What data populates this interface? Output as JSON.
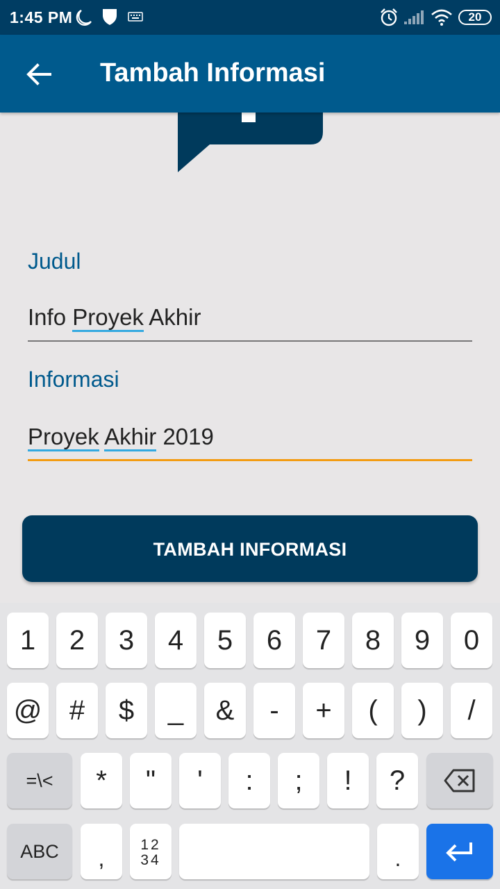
{
  "status_bar": {
    "time": "1:45 PM",
    "battery": "20",
    "icons": [
      "moon-icon",
      "shield-icon",
      "keyboard-icon",
      "alarm-icon",
      "signal-icon",
      "wifi-icon",
      "battery-icon"
    ]
  },
  "app_bar": {
    "title": "Tambah Informasi",
    "back_icon": "back-arrow-icon"
  },
  "form": {
    "judul_label": "Judul",
    "judul_value_words": [
      "Info",
      "Proyek",
      "Akhir"
    ],
    "informasi_label": "Informasi",
    "informasi_value_words": [
      "Proyek",
      "Akhir",
      "2019"
    ],
    "focused_field": "informasi",
    "submit_label": "TAMBAH INFORMASI"
  },
  "colors": {
    "status_bar": "#003d63",
    "app_bar": "#005a8d",
    "label": "#005a8d",
    "button": "#003a5c",
    "focus_underline": "#f39c12",
    "spell_underline": "#33a9e0",
    "enter_key": "#1a73e8"
  },
  "keyboard": {
    "row1": [
      "1",
      "2",
      "3",
      "4",
      "5",
      "6",
      "7",
      "8",
      "9",
      "0"
    ],
    "row2": [
      "@",
      "#",
      "$",
      "_",
      "&",
      "-",
      "+",
      "(",
      ")",
      "/"
    ],
    "row3_switch": "=\\<",
    "row3": [
      "*",
      "\"",
      "'",
      ":",
      ";",
      "!",
      "?"
    ],
    "row4_abc": "ABC",
    "row4_comma": ",",
    "row4_numpad_top": "12",
    "row4_numpad_bottom": "34",
    "row4_period": ".",
    "backspace_icon": "backspace-icon",
    "enter_icon": "enter-icon"
  }
}
